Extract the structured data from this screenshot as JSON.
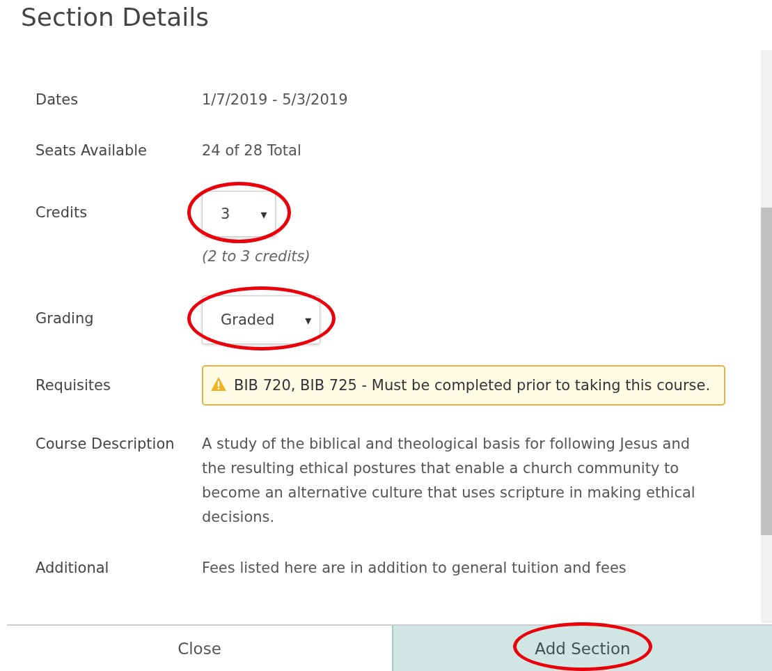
{
  "title": "Section Details",
  "fields": [
    {
      "kind": "text",
      "label": "Dates",
      "value": "1/7/2019 - 5/3/2019"
    },
    {
      "kind": "text",
      "label": "Seats Available",
      "value": "24 of 28 Total"
    },
    {
      "kind": "select",
      "label": "Credits",
      "value": "3",
      "arrow": "▾",
      "hint": "(2 to 3 credits)",
      "circled": true
    },
    {
      "kind": "select",
      "label": "Grading",
      "value": "Graded",
      "arrow": "▾",
      "circled": true
    },
    {
      "kind": "warning",
      "label": "Requisites",
      "value": "BIB 720, BIB 725 - Must be completed prior to taking this course."
    },
    {
      "kind": "text",
      "label": "Course Description",
      "value": "A study of the biblical and theological basis for following Jesus and the resulting ethical postures that enable a church community to become an alternative culture that uses scripture in making ethical decisions."
    },
    {
      "kind": "text",
      "label": "Additional",
      "value": "Fees listed here are in addition to general tuition and fees"
    }
  ],
  "buttons": [
    {
      "kind": "secondary",
      "label": "Close",
      "circled": false
    },
    {
      "kind": "primary",
      "label": "Add Section",
      "circled": true
    }
  ]
}
